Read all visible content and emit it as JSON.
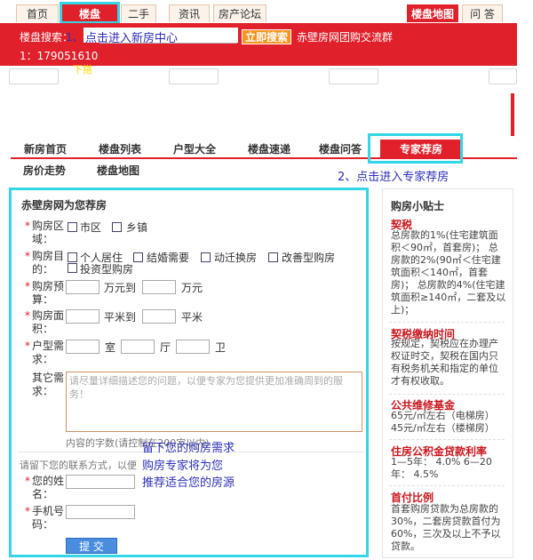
{
  "topnav": {
    "tabs": [
      "首页",
      "楼盘",
      "二手",
      "资讯",
      "房产论坛"
    ],
    "right_tabs": [
      "楼盘地图",
      "问 答"
    ]
  },
  "search": {
    "label": "楼盘搜索：",
    "button": "立即搜索",
    "group_text": "赤壁房网团购交流群",
    "group_number": "1：179051610",
    "hot_fragment": "下搭"
  },
  "annotations": {
    "step1_num": "1、",
    "step1_text": "点击进入新房中心",
    "step2": "2、点击进入专家荐房",
    "note_lines": [
      "留下您的购房需求",
      "购房专家将为您",
      "推荐适合您的房源"
    ]
  },
  "housenav": {
    "row1": [
      "新房首页",
      "楼盘列表",
      "户型大全",
      "楼盘速递",
      "楼盘问答",
      "专家荐房"
    ],
    "row2": [
      "房价走势",
      "楼盘地图"
    ]
  },
  "form": {
    "title": "赤壁房网为您荐房",
    "area_label": "购房区域：",
    "area_options": [
      "市区",
      "乡镇"
    ],
    "purpose_label": "购房目的：",
    "purpose_options": [
      "个人居住",
      "结婚需要",
      "动迁换房",
      "改善型购房",
      "投资型购房"
    ],
    "budget_label": "购房预算：",
    "budget_mid": "万元到",
    "budget_unit": "万元",
    "size_label": "购房面积：",
    "size_mid": "平米到",
    "size_unit": "平米",
    "layout_label": "户型需求：",
    "layout_units": [
      "室",
      "厅",
      "卫"
    ],
    "other_label": "其它需求：",
    "other_placeholder": "请尽量详细描述您的问题，以便专家为您提供更加准确周到的服务！",
    "char_hint": "内容的字数(请控制在200字以内)",
    "contact_hint": "请留下您的联系方式，以便",
    "name_label": "您的姓名：",
    "phone_label": "手机号码：",
    "submit": "提 交"
  },
  "sidebar": {
    "title": "购房小贴士",
    "sections": [
      {
        "heading": "契税",
        "body": "总房款的1%(住宅建筑面积＜90㎡，首套房)； 总房款的2%(90㎡＜住宅建筑面积＜140㎡，首套房)； 总房款的4%(住宅建筑面积≥140㎡，二套及以上)；"
      },
      {
        "heading": "契税缴纳时间",
        "body": "按规定，契税应在办理产权证时交，契税在国内只有税务机关和指定的单位才有权收取。"
      },
      {
        "heading": "公共维修基金",
        "body": "65元/㎡左右（电梯房） 45元/㎡左右（楼梯房）"
      },
      {
        "heading": "住房公积金贷款利率",
        "body": "1—5年： 4.0% 6—20年： 4.5%"
      },
      {
        "heading": "首付比例",
        "body": "首套购房贷款为总房款的30%，二套房贷款首付为60%，三次及以上不予以贷款。"
      }
    ]
  },
  "colors": {
    "brand_red": "#e0202a",
    "annotation_cyan": "#33d6e6",
    "annotation_blue": "#2e2eb8"
  }
}
